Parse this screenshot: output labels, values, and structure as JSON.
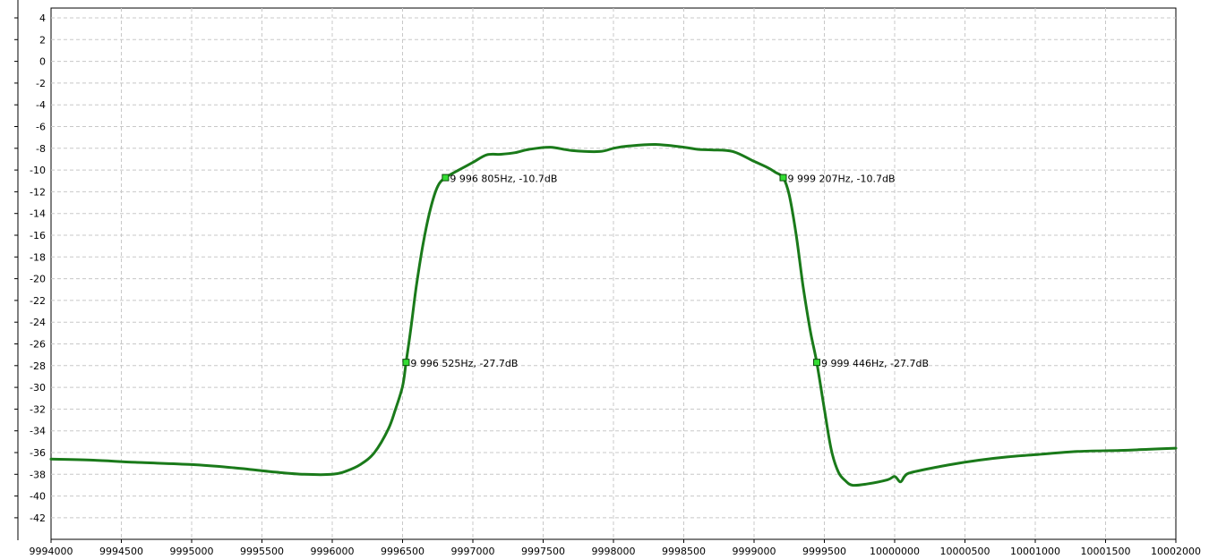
{
  "chart_data": {
    "type": "line",
    "title": "",
    "xlabel": "",
    "ylabel": "",
    "xlim": [
      9994000,
      10002000
    ],
    "ylim": [
      -44,
      5
    ],
    "grid": true,
    "x_ticks": [
      {
        "value": 9994000,
        "label": "9994000"
      },
      {
        "value": 9994500,
        "label": "9994500"
      },
      {
        "value": 9995000,
        "label": "9995000"
      },
      {
        "value": 9995500,
        "label": "9995500"
      },
      {
        "value": 9996000,
        "label": "9996000"
      },
      {
        "value": 9996500,
        "label": "9996500"
      },
      {
        "value": 9997000,
        "label": "9997000"
      },
      {
        "value": 9997500,
        "label": "9997500"
      },
      {
        "value": 9998000,
        "label": "9998000"
      },
      {
        "value": 9998500,
        "label": "9998500"
      },
      {
        "value": 9999000,
        "label": "9999000"
      },
      {
        "value": 9999500,
        "label": "9999500"
      },
      {
        "value": 10000000,
        "label": "10000000"
      },
      {
        "value": 10000500,
        "label": "10000500"
      },
      {
        "value": 10001000,
        "label": "10001000"
      },
      {
        "value": 10001500,
        "label": "10001500"
      },
      {
        "value": 10002000,
        "label": "10002000"
      }
    ],
    "y_ticks": [
      {
        "value": 4,
        "label": "4"
      },
      {
        "value": 2,
        "label": "2"
      },
      {
        "value": 0,
        "label": "0"
      },
      {
        "value": -2,
        "label": "-2"
      },
      {
        "value": -4,
        "label": "-4"
      },
      {
        "value": -6,
        "label": "-6"
      },
      {
        "value": -8,
        "label": "-8"
      },
      {
        "value": -10,
        "label": "-10"
      },
      {
        "value": -12,
        "label": "-12"
      },
      {
        "value": -14,
        "label": "-14"
      },
      {
        "value": -16,
        "label": "-16"
      },
      {
        "value": -18,
        "label": "-18"
      },
      {
        "value": -20,
        "label": "-20"
      },
      {
        "value": -22,
        "label": "-22"
      },
      {
        "value": -24,
        "label": "-24"
      },
      {
        "value": -26,
        "label": "-26"
      },
      {
        "value": -28,
        "label": "-28"
      },
      {
        "value": -30,
        "label": "-30"
      },
      {
        "value": -32,
        "label": "-32"
      },
      {
        "value": -34,
        "label": "-34"
      },
      {
        "value": -36,
        "label": "-36"
      },
      {
        "value": -38,
        "label": "-38"
      },
      {
        "value": -40,
        "label": "-40"
      },
      {
        "value": -42,
        "label": "-42"
      }
    ],
    "series": [
      {
        "color": "#1a7a1a",
        "x": [
          9994000,
          9994300,
          9994600,
          9995000,
          9995300,
          9995600,
          9995800,
          9996000,
          9996100,
          9996200,
          9996300,
          9996400,
          9996450,
          9996500,
          9996525,
          9996560,
          9996600,
          9996650,
          9996700,
          9996750,
          9996805,
          9996900,
          9997000,
          9997100,
          9997200,
          9997300,
          9997400,
          9997550,
          9997700,
          9997900,
          9998000,
          9998100,
          9998300,
          9998500,
          9998600,
          9998700,
          9998850,
          9999000,
          9999100,
          9999150,
          9999207,
          9999250,
          9999300,
          9999350,
          9999400,
          9999446,
          9999500,
          9999550,
          9999600,
          9999650,
          9999700,
          9999800,
          9999950,
          10000000,
          10000040,
          10000070,
          10000100,
          10000200,
          10000400,
          10000600,
          10000800,
          10001000,
          10001300,
          10001600,
          10001800,
          10002000
        ],
        "y": [
          -36.6,
          -36.7,
          -36.9,
          -37.1,
          -37.4,
          -37.8,
          -38.0,
          -38.0,
          -37.7,
          -37.1,
          -36.0,
          -33.8,
          -32.0,
          -29.9,
          -27.7,
          -24.5,
          -20.5,
          -16.5,
          -13.5,
          -11.5,
          -10.7,
          -10.0,
          -9.3,
          -8.6,
          -8.55,
          -8.4,
          -8.1,
          -7.9,
          -8.2,
          -8.3,
          -8.0,
          -7.8,
          -7.65,
          -7.9,
          -8.1,
          -8.15,
          -8.3,
          -9.2,
          -9.8,
          -10.2,
          -10.7,
          -12.3,
          -16.0,
          -20.8,
          -24.8,
          -27.7,
          -32.0,
          -35.8,
          -37.8,
          -38.6,
          -39.0,
          -38.9,
          -38.5,
          -38.2,
          -38.7,
          -38.2,
          -37.9,
          -37.6,
          -37.1,
          -36.7,
          -36.4,
          -36.2,
          -35.9,
          -35.8,
          -35.7,
          -35.6
        ]
      }
    ],
    "markers": [
      {
        "x": 9996805,
        "y": -10.7,
        "label": "9 996 805Hz, -10.7dB"
      },
      {
        "x": 9996525,
        "y": -27.7,
        "label": "9 996 525Hz, -27.7dB"
      },
      {
        "x": 9999207,
        "y": -10.7,
        "label": "9 999 207Hz, -10.7dB"
      },
      {
        "x": 9999446,
        "y": -27.7,
        "label": "9 999 446Hz, -27.7dB"
      }
    ],
    "marker_color": "#33dd33"
  }
}
